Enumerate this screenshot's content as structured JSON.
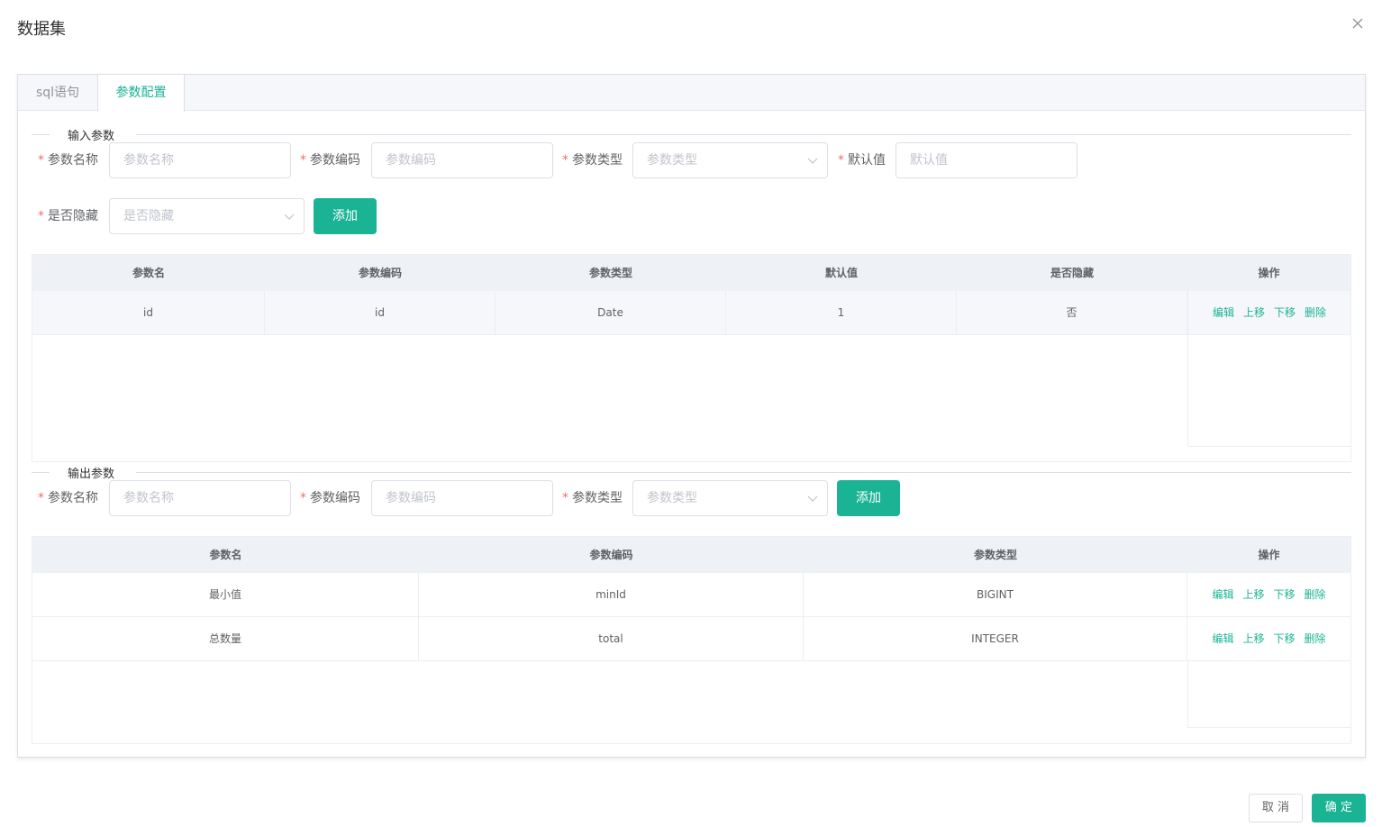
{
  "dialog": {
    "title": "数据集"
  },
  "tabs": [
    {
      "label": "sql语句",
      "active": false
    },
    {
      "label": "参数配置",
      "active": true
    }
  ],
  "input_section": {
    "legend": "输入参数",
    "fields": {
      "name": {
        "label": "参数名称",
        "placeholder": "参数名称"
      },
      "code": {
        "label": "参数编码",
        "placeholder": "参数编码"
      },
      "type": {
        "label": "参数类型",
        "placeholder": "参数类型"
      },
      "default": {
        "label": "默认值",
        "placeholder": "默认值"
      },
      "hidden": {
        "label": "是否隐藏",
        "placeholder": "是否隐藏"
      }
    },
    "add_label": "添加",
    "columns": [
      "参数名",
      "参数编码",
      "参数类型",
      "默认值",
      "是否隐藏",
      "操作"
    ],
    "rows": [
      {
        "name": "id",
        "code": "id",
        "type": "Date",
        "default": "1",
        "hidden": "否"
      }
    ]
  },
  "output_section": {
    "legend": "输出参数",
    "fields": {
      "name": {
        "label": "参数名称",
        "placeholder": "参数名称"
      },
      "code": {
        "label": "参数编码",
        "placeholder": "参数编码"
      },
      "type": {
        "label": "参数类型",
        "placeholder": "参数类型"
      }
    },
    "add_label": "添加",
    "columns": [
      "参数名",
      "参数编码",
      "参数类型",
      "操作"
    ],
    "rows": [
      {
        "name": "最小值",
        "code": "minId",
        "type": "BIGINT"
      },
      {
        "name": "总数量",
        "code": "total",
        "type": "INTEGER"
      }
    ]
  },
  "row_actions": {
    "edit": "编辑",
    "up": "上移",
    "down": "下移",
    "delete": "删除"
  },
  "footer": {
    "cancel_label": "取 消",
    "ok_label": "确 定"
  },
  "colors": {
    "primary": "#1ab394",
    "required": "#f56c6c"
  }
}
